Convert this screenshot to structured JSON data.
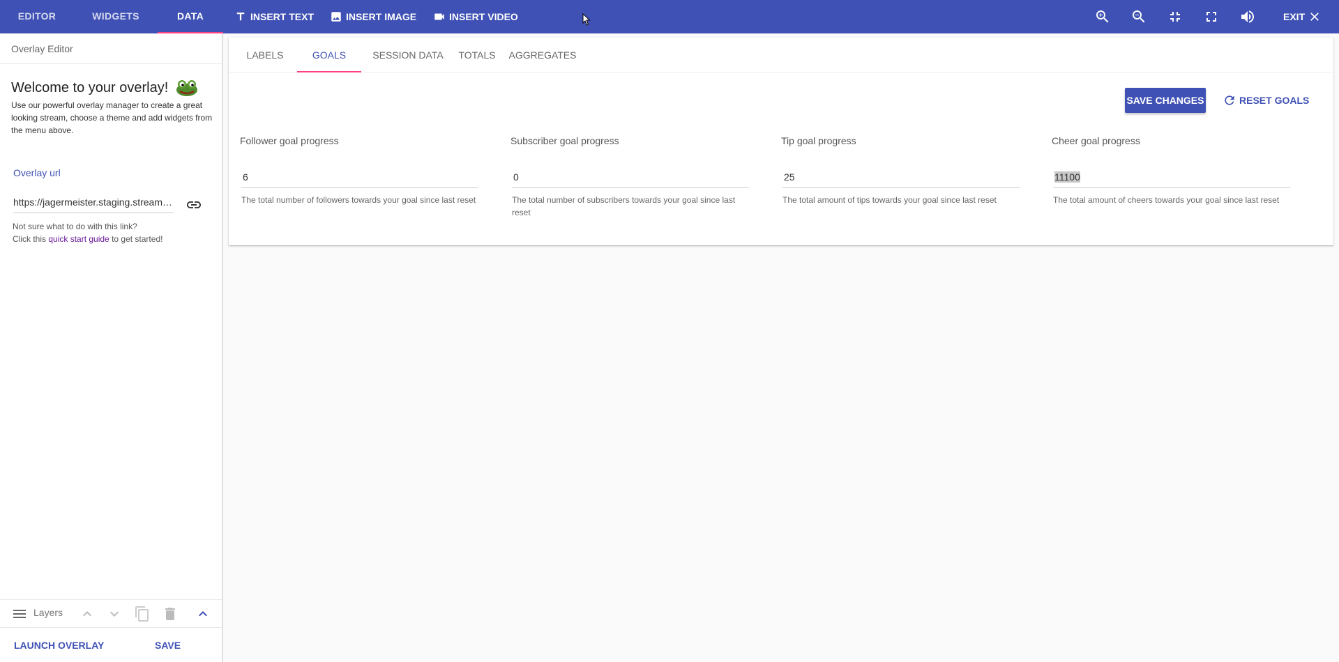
{
  "topbar": {
    "tabs": [
      "EDITOR",
      "WIDGETS",
      "DATA"
    ],
    "actions": [
      "INSERT TEXT",
      "INSERT IMAGE",
      "INSERT VIDEO"
    ],
    "icons": [
      "zoom-in-icon",
      "zoom-out-icon",
      "fullscreen-exit-icon",
      "fullscreen-icon",
      "volume-icon"
    ],
    "exit_label": "EXIT",
    "accent": "#3f51b5",
    "indicator": "#ff4081"
  },
  "sidebar": {
    "header": "Overlay Editor",
    "welcome_title": "Welcome to your overlay!",
    "welcome_desc": "Use our powerful overlay manager to create a great looking stream, choose a theme and add widgets from the menu above.",
    "overlay_url_label": "Overlay url",
    "overlay_url": "https://jagermeister.staging.streamelements.com",
    "help_line1": "Not sure what to do with this link?",
    "help_pre": "Click this ",
    "help_link": "quick start guide",
    "help_post": " to get started!",
    "layers_label": "Layers",
    "launch_label": "LAUNCH OVERLAY",
    "save_label": "SAVE"
  },
  "main": {
    "subtabs": [
      "LABELS",
      "GOALS",
      "SESSION DATA",
      "TOTALS",
      "AGGREGATES"
    ],
    "active_subtab": "GOALS",
    "save_changes": "SAVE CHANGES",
    "reset_goals": "RESET GOALS",
    "goals": [
      {
        "label": "Follower goal progress",
        "value": "6",
        "hint": "The total number of followers towards your goal since last reset"
      },
      {
        "label": "Subscriber goal progress",
        "value": "0",
        "hint": "The total number of subscribers towards your goal since last reset"
      },
      {
        "label": "Tip goal progress",
        "value": "25",
        "hint": "The total amount of tips towards your goal since last reset"
      },
      {
        "label": "Cheer goal progress",
        "value": "11100",
        "hint": "The total amount of cheers towards your goal since last reset"
      }
    ]
  }
}
